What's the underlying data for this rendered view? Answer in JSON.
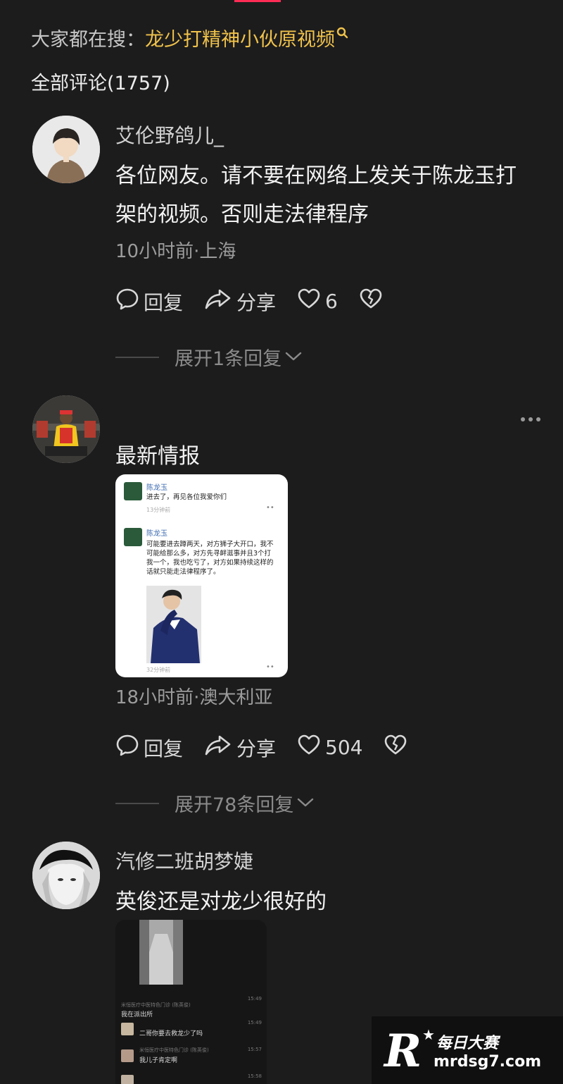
{
  "hot_search": {
    "prefix": "大家都在搜：",
    "keyword": "龙少打精神小伙原视频"
  },
  "comments_header": "全部评论(1757)",
  "comments": [
    {
      "username": "艾伦野鸽儿_",
      "text_line1": "各位网友。请不要在网络上发关于陈龙玉打",
      "text_line2": "架的视频。否则走法律程序",
      "meta": "10小时前·上海",
      "reply_label": "回复",
      "share_label": "分享",
      "like_count": "6",
      "expand_label": "展开1条回复"
    },
    {
      "username": "",
      "text": "最新情报",
      "meta": "18小时前·澳大利亚",
      "reply_label": "回复",
      "share_label": "分享",
      "like_count": "504",
      "expand_label": "展开78条回复",
      "image": {
        "posts": [
          {
            "name": "陈龙玉",
            "text": "进去了，再见各位我爱你们",
            "time": "13分钟前"
          },
          {
            "name": "陈龙玉",
            "text": "可能要进去蹲两天，对方狮子大开口，我不可能给那么多，对方先寻衅滋事并且3个打我一个，我也吃亏了，对方如果持续这样的话就只能走法律程序了。",
            "time": "32分钟前"
          }
        ]
      }
    },
    {
      "username": "汽修二班胡梦婕",
      "text": "英俊还是对龙少很好的",
      "image": {
        "rows": [
          {
            "sender": "米恒医疗中医特色门诊 (陈英俊)",
            "time": "15:49",
            "text": "我在派出所"
          },
          {
            "sender": "",
            "time": "15:49",
            "text": "二哥你要去救龙少了吗"
          },
          {
            "sender": "米恒医疗中医特色门诊 (陈英俊)",
            "time": "15:57",
            "text": "我儿子肯定啊"
          },
          {
            "sender": "",
            "time": "15:58",
            "text": ""
          }
        ]
      }
    }
  ],
  "watermark": {
    "brand": "每日大赛",
    "url": "mrdsg7.com",
    "logo_letter": "R"
  },
  "colors": {
    "background": "#1c1c1d",
    "keyword": "#f0c24b",
    "accent": "#fe2c55"
  }
}
